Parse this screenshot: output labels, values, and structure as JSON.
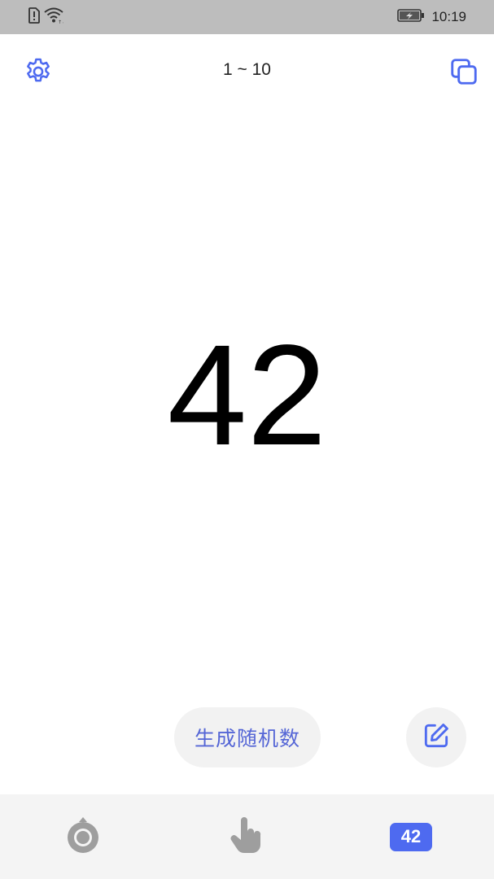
{
  "status_bar": {
    "time": "10:19",
    "icons": [
      "sim-alert-icon",
      "wifi-icon",
      "battery-charging-icon"
    ]
  },
  "toolbar": {
    "range_label": "1 ~ 10",
    "settings_icon": "gear-icon",
    "copy_icon": "copy-icon"
  },
  "main": {
    "number": "42"
  },
  "actions": {
    "generate_label": "生成随机数",
    "edit_icon": "edit-icon"
  },
  "bottom_nav": {
    "items": [
      {
        "icon": "wheel-icon"
      },
      {
        "icon": "tap-hand-icon"
      },
      {
        "icon": "number-badge-icon",
        "label": "42"
      }
    ]
  },
  "colors": {
    "accent": "#4e6af0",
    "accent_text": "#5566d6",
    "status_bar": "#bdbdbd",
    "nav_bg": "#f4f4f4"
  }
}
